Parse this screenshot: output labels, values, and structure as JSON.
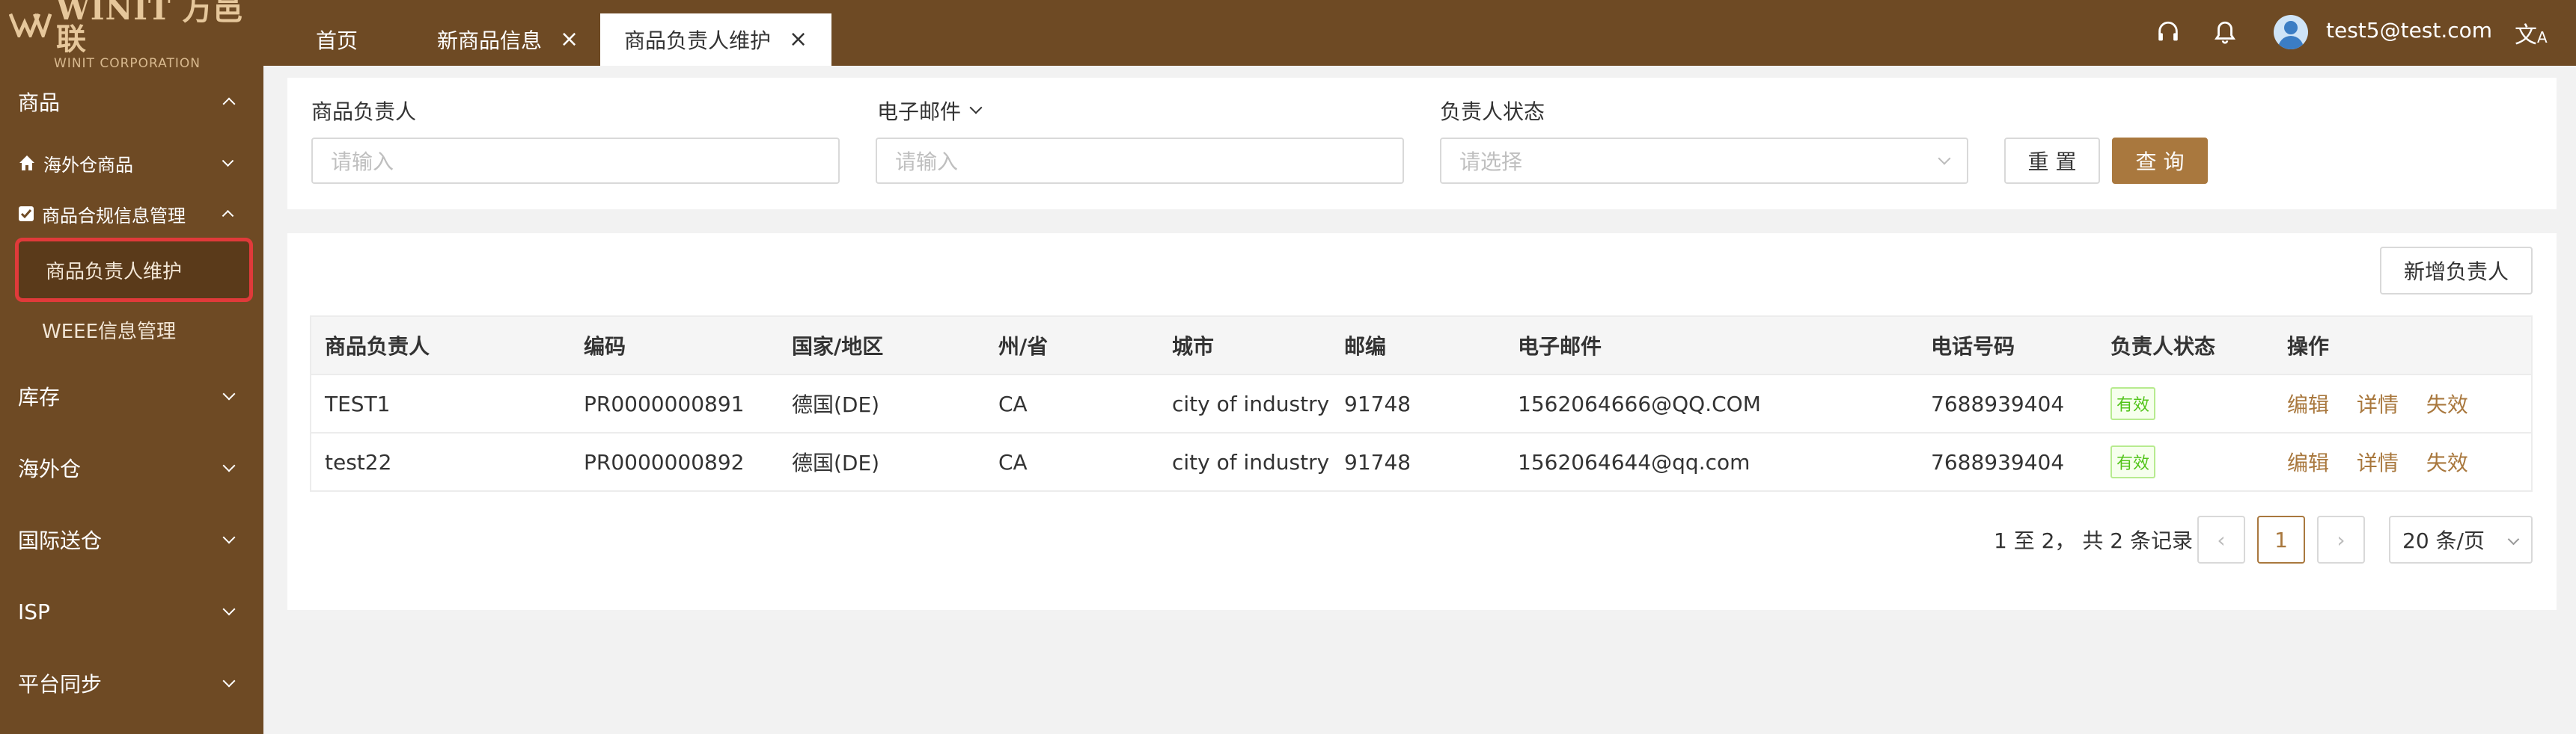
{
  "brand": {
    "logo_text": "WINIT 万邑联",
    "logo_sub": "WINIT CORPORATION"
  },
  "sidebar": {
    "groups": [
      {
        "label": "商品"
      },
      {
        "label": "库存"
      },
      {
        "label": "海外仓"
      },
      {
        "label": "国际送仓"
      },
      {
        "label": "ISP"
      },
      {
        "label": "平台同步"
      }
    ],
    "sub_items": [
      {
        "label": "海外仓商品"
      },
      {
        "label": "商品合规信息管理"
      }
    ],
    "leaf_items": [
      {
        "label": "商品负责人维护"
      },
      {
        "label": "WEEE信息管理"
      }
    ]
  },
  "tabs": [
    {
      "label": "首页"
    },
    {
      "label": "新商品信息"
    },
    {
      "label": "商品负责人维护"
    }
  ],
  "header": {
    "user_email": "test5@test.com"
  },
  "filters": {
    "owner_label": "商品负责人",
    "owner_placeholder": "请输入",
    "email_label": "电子邮件",
    "email_placeholder": "请输入",
    "status_label": "负责人状态",
    "status_placeholder": "请选择",
    "reset_label": "重 置",
    "query_label": "查 询"
  },
  "add_button": "新增负责人",
  "table": {
    "columns": [
      "商品负责人",
      "编码",
      "国家/地区",
      "州/省",
      "城市",
      "邮编",
      "电子邮件",
      "电话号码",
      "负责人状态",
      "操作"
    ],
    "rows": [
      {
        "owner": "TEST1",
        "code": "PR0000000891",
        "country": "德国(DE)",
        "state": "CA",
        "city": "city of industry",
        "zip": "91748",
        "email": "1562064666@QQ.COM",
        "phone": "7688939404",
        "status": "有效"
      },
      {
        "owner": "test22",
        "code": "PR0000000892",
        "country": "德国(DE)",
        "state": "CA",
        "city": "city of industry",
        "zip": "91748",
        "email": "1562064644@qq.com",
        "phone": "7688939404",
        "status": "有效"
      }
    ],
    "actions": {
      "edit": "编辑",
      "detail": "详情",
      "disable": "失效"
    }
  },
  "pagination": {
    "summary": "1 至 2， 共 2 条记录",
    "current_page": "1",
    "page_size": "20 条/页"
  },
  "colors": {
    "sidebar_bg": "#6e4a24",
    "accent": "#a9783e",
    "highlight_border": "#e03a3a",
    "status_green": "#52c41a"
  },
  "icons": [
    "home-icon",
    "checkbox-icon",
    "headset-icon",
    "bell-icon",
    "avatar",
    "translate-icon",
    "chevron-down-icon",
    "chevron-up-icon",
    "close-icon"
  ]
}
